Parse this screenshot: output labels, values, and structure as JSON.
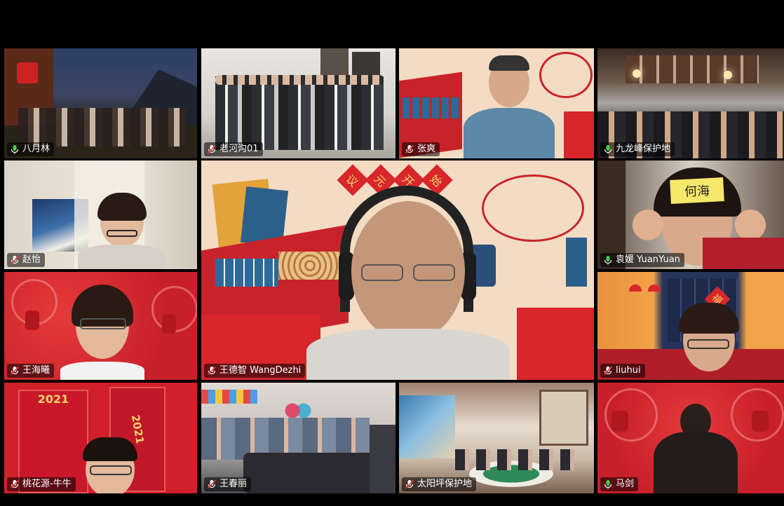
{
  "participants": [
    {
      "name": "八月林",
      "mic": "active"
    },
    {
      "name": "老河沟01",
      "mic": "muted"
    },
    {
      "name": "张爽",
      "mic": "muted"
    },
    {
      "name": "九龙峰保护地",
      "mic": "active"
    },
    {
      "name": "赵怡",
      "mic": "muted"
    },
    {
      "name": "王德智 WangDezhi",
      "mic": "muted"
    },
    {
      "name": "袁媛 YuanYuan",
      "mic": "active"
    },
    {
      "name": "王海曦",
      "mic": "muted"
    },
    {
      "name": "liuhui",
      "mic": "muted"
    },
    {
      "name": "桃花源-牛牛",
      "mic": "muted"
    },
    {
      "name": "王春丽",
      "mic": "muted"
    },
    {
      "name": "太阳坪保护地",
      "mic": "muted"
    },
    {
      "name": "马剑",
      "mic": "active"
    }
  ],
  "scene_text": {
    "banner_chars": [
      "议",
      "元",
      "开",
      "始"
    ],
    "sign_text": "何海",
    "year_label": "2021",
    "year_label_2": "2021",
    "fu_char": "福"
  },
  "colors": {
    "mic_active": "#3ecf4a",
    "mic_muted": "#ffffff",
    "mic_slash": "#e53935",
    "festive_red": "#d8262b",
    "festive_bg": "#f3dcc3"
  }
}
